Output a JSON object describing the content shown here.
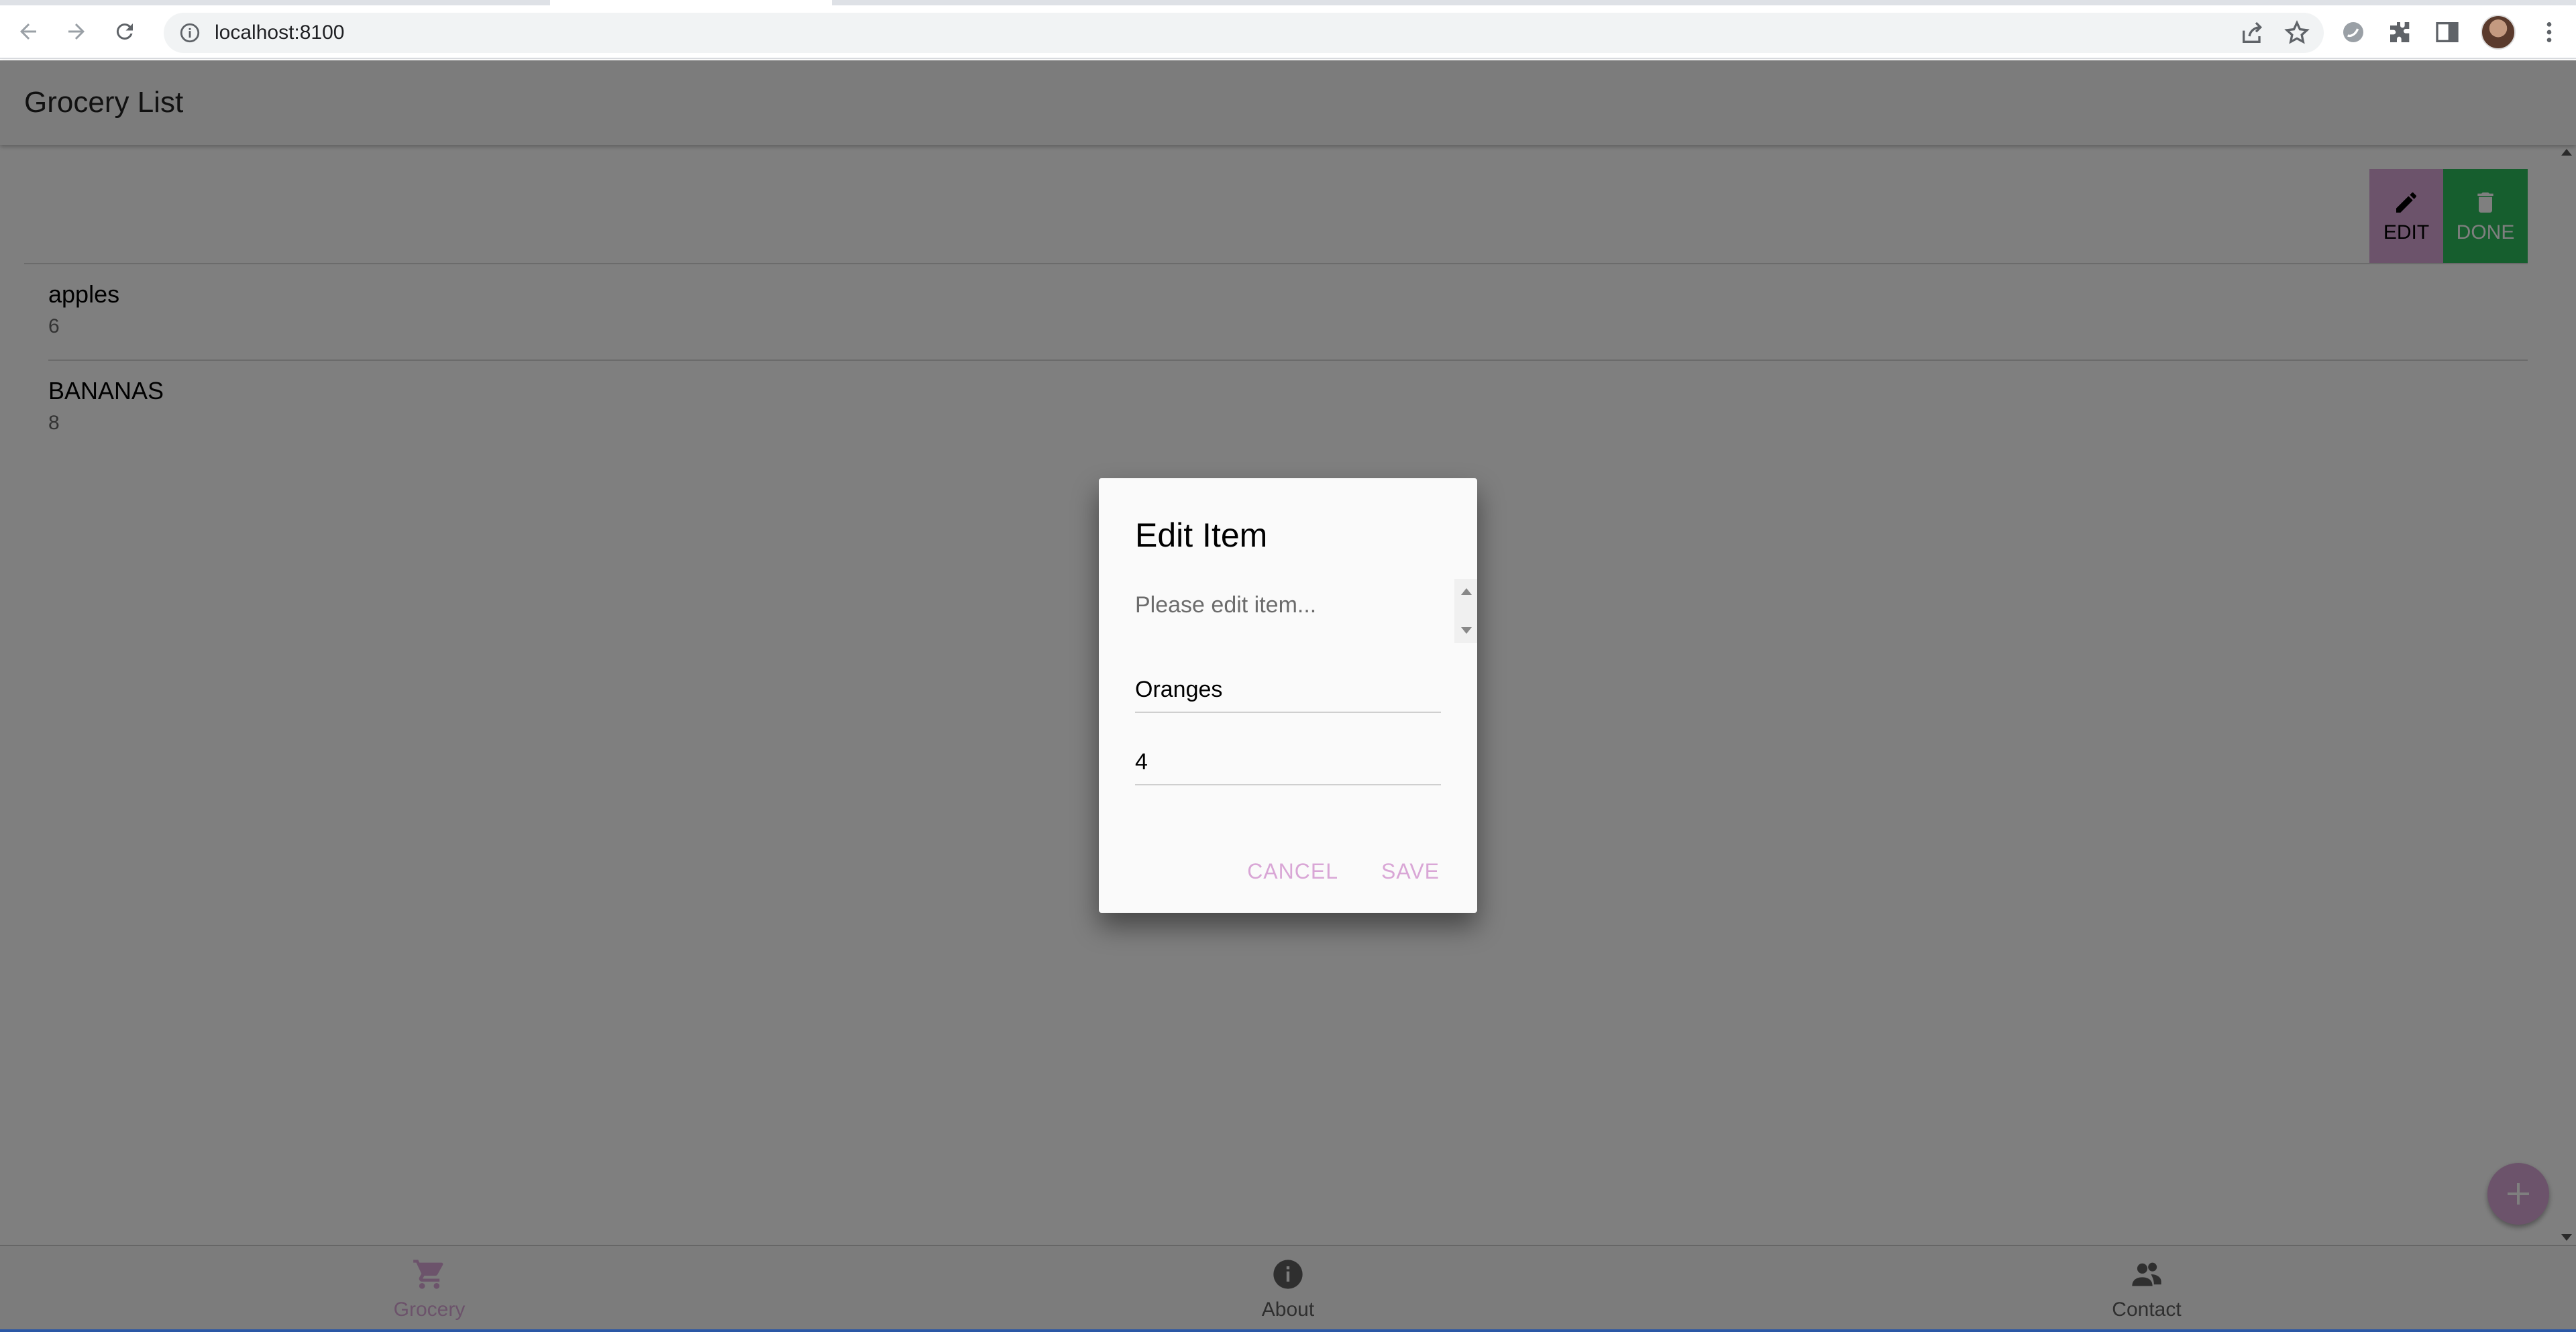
{
  "browser": {
    "url": "localhost:8100",
    "icons": [
      "back-icon",
      "forward-icon",
      "reload-icon",
      "info-icon",
      "share-icon",
      "star-icon",
      "extension-swirl-icon",
      "puzzle-icon",
      "sidepanel-icon",
      "profile-avatar",
      "menu-kebab-icon"
    ]
  },
  "app": {
    "title": "Grocery List",
    "options": {
      "edit_label": "EDIT",
      "done_label": "DONE"
    },
    "items": [
      {
        "name": "apples",
        "quantity": "6"
      },
      {
        "name": "BANANAS",
        "quantity": "8"
      }
    ],
    "tabs": [
      {
        "label": "Grocery",
        "icon": "cart-icon",
        "selected": true
      },
      {
        "label": "About",
        "icon": "info-circle-icon",
        "selected": false
      },
      {
        "label": "Contact",
        "icon": "people-icon",
        "selected": false
      }
    ],
    "colors": {
      "primary": "#d9a6d6",
      "done": "#2dbc5c"
    }
  },
  "dialog": {
    "title": "Edit Item",
    "message": "Please edit item...",
    "fields": [
      {
        "value": "Oranges"
      },
      {
        "value": "4"
      }
    ],
    "cancel_label": "CANCEL",
    "save_label": "SAVE"
  }
}
